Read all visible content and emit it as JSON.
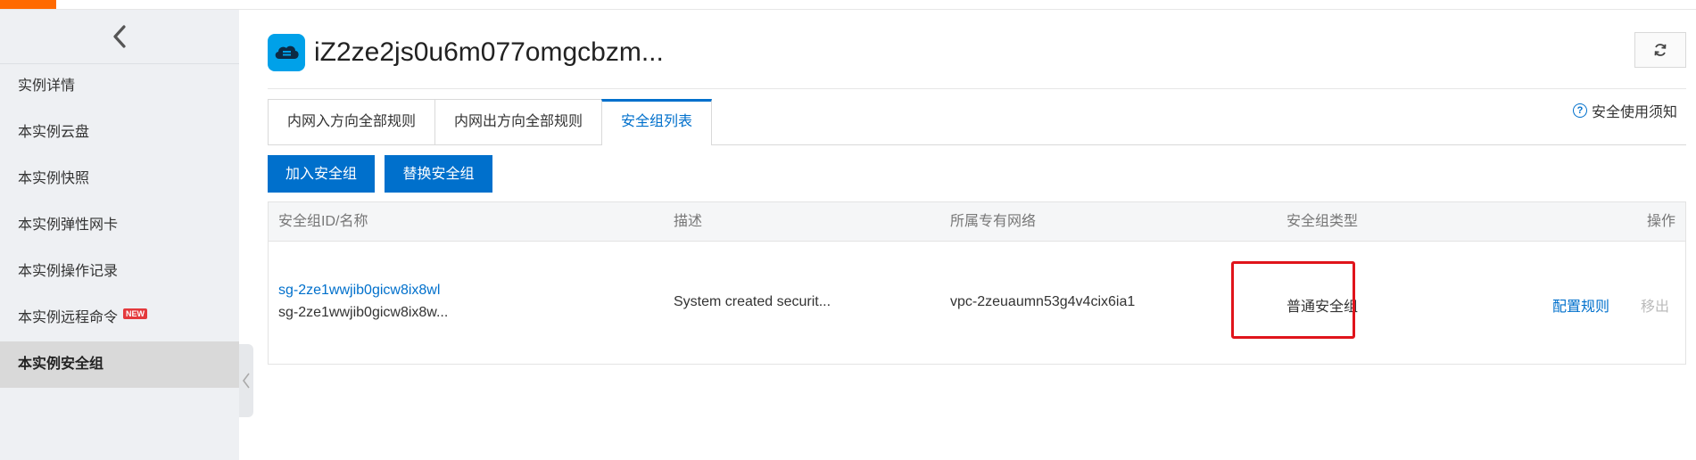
{
  "sidebar": {
    "items": [
      {
        "label": "实例详情"
      },
      {
        "label": "本实例云盘"
      },
      {
        "label": "本实例快照"
      },
      {
        "label": "本实例弹性网卡"
      },
      {
        "label": "本实例操作记录"
      },
      {
        "label": "本实例远程命令",
        "badge": "NEW"
      },
      {
        "label": "本实例安全组",
        "active": true
      }
    ]
  },
  "header": {
    "title": "iZ2ze2js0u6m077omgcbzm..."
  },
  "tabs": [
    {
      "label": "内网入方向全部规则"
    },
    {
      "label": "内网出方向全部规则"
    },
    {
      "label": "安全组列表",
      "active": true
    }
  ],
  "notice": {
    "label": "安全使用须知"
  },
  "toolbar": {
    "join_label": "加入安全组",
    "replace_label": "替换安全组"
  },
  "table": {
    "columns": [
      "安全组ID/名称",
      "描述",
      "所属专有网络",
      "安全组类型",
      "操作"
    ],
    "rows": [
      {
        "id": "sg-2ze1wwjib0gicw8ix8wl",
        "name": "sg-2ze1wwjib0gicw8ix8w...",
        "description": "System created securit...",
        "vpc": "vpc-2zeuaumn53g4v4cix6ia1",
        "type": "普通安全组",
        "actions": {
          "configure": "配置规则",
          "remove": "移出"
        }
      }
    ]
  },
  "colors": {
    "accent": "#0070cc",
    "brand_orange": "#ff6a00",
    "highlight": "#e0141b",
    "instance_icon": "#00a1e9"
  }
}
